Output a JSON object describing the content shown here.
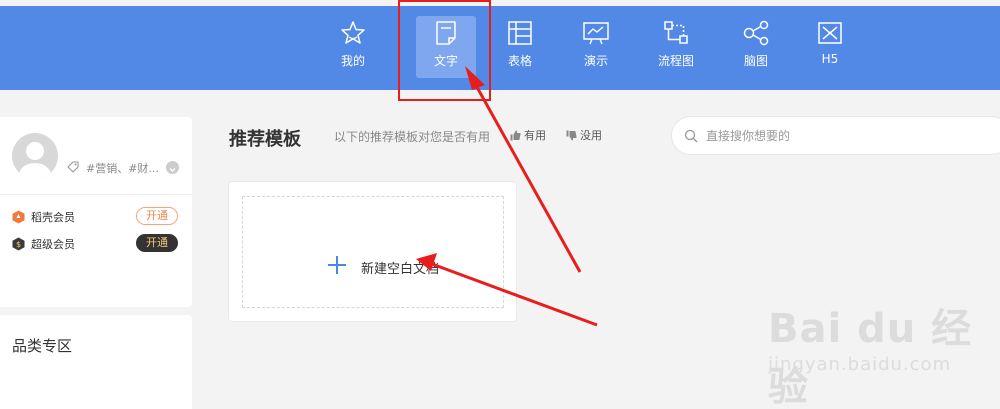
{
  "topnav": {
    "items": [
      {
        "label": "我的",
        "icon": "star-icon"
      },
      {
        "label": "文字",
        "icon": "document-icon",
        "active": true
      },
      {
        "label": "表格",
        "icon": "table-icon"
      },
      {
        "label": "演示",
        "icon": "presentation-icon"
      },
      {
        "label": "流程图",
        "icon": "flowchart-icon"
      },
      {
        "label": "脑图",
        "icon": "mindmap-icon"
      },
      {
        "label": "H5",
        "icon": "h5-icon"
      }
    ]
  },
  "profile": {
    "tags": "#营销、#财...",
    "members": [
      {
        "label": "稻壳会员",
        "button": "开通"
      },
      {
        "label": "超级会员",
        "button": "开通"
      }
    ]
  },
  "category": {
    "title": "品类专区"
  },
  "templates": {
    "title": "推荐模板",
    "feedback_question": "以下的推荐模板对您是否有用",
    "useful": "有用",
    "useless": "没用"
  },
  "search": {
    "placeholder": "直接搜你想要的"
  },
  "new_doc": {
    "label": "新建空白文档"
  },
  "watermark": {
    "main": "Bai du 经验",
    "sub": "jingyan.baidu.com"
  },
  "colors": {
    "nav_bg": "#5389e6",
    "annotation": "#e81e1e",
    "plus": "#4a86e8"
  }
}
